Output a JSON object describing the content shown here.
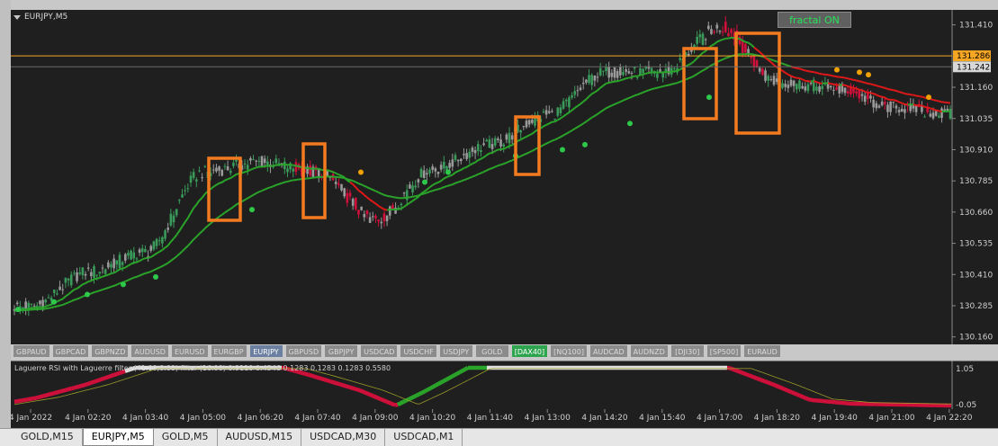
{
  "symbol_title": "EURJPY,M5",
  "fractal_button": "fractal ON",
  "price_axis": {
    "ticks": [
      "131.410",
      "131.160",
      "131.035",
      "130.910",
      "130.785",
      "130.660",
      "130.535",
      "130.410",
      "130.285",
      "130.160"
    ],
    "ask_label": "131.286",
    "bid_label": "131.242",
    "ask_color": "#f5a623"
  },
  "time_axis": {
    "ticks": [
      "4 Jan 2022",
      "4 Jan 02:20",
      "4 Jan 03:40",
      "4 Jan 05:00",
      "4 Jan 06:20",
      "4 Jan 07:40",
      "4 Jan 09:00",
      "4 Jan 10:20",
      "4 Jan 11:40",
      "4 Jan 13:00",
      "4 Jan 14:20",
      "4 Jan 15:40",
      "4 Jan 17:00",
      "4 Jan 18:20",
      "4 Jan 19:40",
      "4 Jan 21:00",
      "4 Jan 22:20"
    ]
  },
  "symbol_buttons": [
    {
      "label": "GBPAUD",
      "state": "normal"
    },
    {
      "label": "GBPCAD",
      "state": "normal"
    },
    {
      "label": "GBPNZD",
      "state": "normal"
    },
    {
      "label": "AUDUSD",
      "state": "normal"
    },
    {
      "label": "EURUSD",
      "state": "normal"
    },
    {
      "label": "EURGBP",
      "state": "normal"
    },
    {
      "label": "EURJPY",
      "state": "active"
    },
    {
      "label": "GBPUSD",
      "state": "normal"
    },
    {
      "label": "GBPJPY",
      "state": "normal"
    },
    {
      "label": "USDCAD",
      "state": "normal"
    },
    {
      "label": "USDCHF",
      "state": "normal"
    },
    {
      "label": "USDJPY",
      "state": "normal"
    },
    {
      "label": "GOLD",
      "state": "normal"
    },
    {
      "label": "[DAX40]",
      "state": "green"
    },
    {
      "label": "[NQ100]",
      "state": "normal"
    },
    {
      "label": "AUDCAD",
      "state": "normal"
    },
    {
      "label": "AUDNZD",
      "state": "normal"
    },
    {
      "label": "[DJI30]",
      "state": "normal"
    },
    {
      "label": "[SP500]",
      "state": "normal"
    },
    {
      "label": "EURAUD",
      "state": "normal"
    }
  ],
  "indicator": {
    "title": "Laguerre RSI with Laguerre filter (41.00,0.00) filter (16.00) 0.9110 0.4346 0.1283 0.1283 0.1283 0.5580",
    "axis_ticks": [
      "1.05",
      "-0.05"
    ]
  },
  "tabs": [
    {
      "label": "GOLD,M15",
      "active": false
    },
    {
      "label": "EURJPY,M5",
      "active": true
    },
    {
      "label": "GOLD,M5",
      "active": false
    },
    {
      "label": "AUDUSD,M15",
      "active": false
    },
    {
      "label": "USDCAD,M30",
      "active": false
    },
    {
      "label": "USDCAD,M1",
      "active": false
    }
  ],
  "colors": {
    "background": "#1f1f1f",
    "bull_candle": "#3a9a5a",
    "bear_candle": "#d0103a",
    "neutral_candle": "#9a9a9a",
    "ma_green": "#2aa52a",
    "ma_red": "#e01818",
    "highlight_box": "#f47a20",
    "dot_green": "#2ec84a",
    "dot_orange": "#f0a000"
  },
  "chart_data": {
    "type": "candlestick",
    "title": "EURJPY,M5",
    "ylim": [
      130.13,
      131.47
    ],
    "price_path": [
      {
        "t": "4 Jan 2022",
        "p": 130.28
      },
      {
        "t": "4 Jan 02:20",
        "p": 130.42
      },
      {
        "t": "4 Jan 03:40",
        "p": 130.5
      },
      {
        "t": "4 Jan 05:00",
        "p": 130.82
      },
      {
        "t": "4 Jan 06:20",
        "p": 130.86
      },
      {
        "t": "4 Jan 07:40",
        "p": 130.82
      },
      {
        "t": "4 Jan 09:00",
        "p": 130.63
      },
      {
        "t": "4 Jan 10:20",
        "p": 130.83
      },
      {
        "t": "4 Jan 11:40",
        "p": 130.93
      },
      {
        "t": "4 Jan 13:00",
        "p": 131.05
      },
      {
        "t": "4 Jan 14:20",
        "p": 131.22
      },
      {
        "t": "4 Jan 15:40",
        "p": 131.22
      },
      {
        "t": "4 Jan 17:00",
        "p": 131.4
      },
      {
        "t": "4 Jan 18:20",
        "p": 131.18
      },
      {
        "t": "4 Jan 19:40",
        "p": 131.16
      },
      {
        "t": "4 Jan 21:00",
        "p": 131.08
      },
      {
        "t": "4 Jan 22:20",
        "p": 131.05
      }
    ],
    "horizontal_levels": [
      {
        "label": "131.286",
        "value": 131.286
      },
      {
        "label": "131.242",
        "value": 131.242
      }
    ]
  }
}
